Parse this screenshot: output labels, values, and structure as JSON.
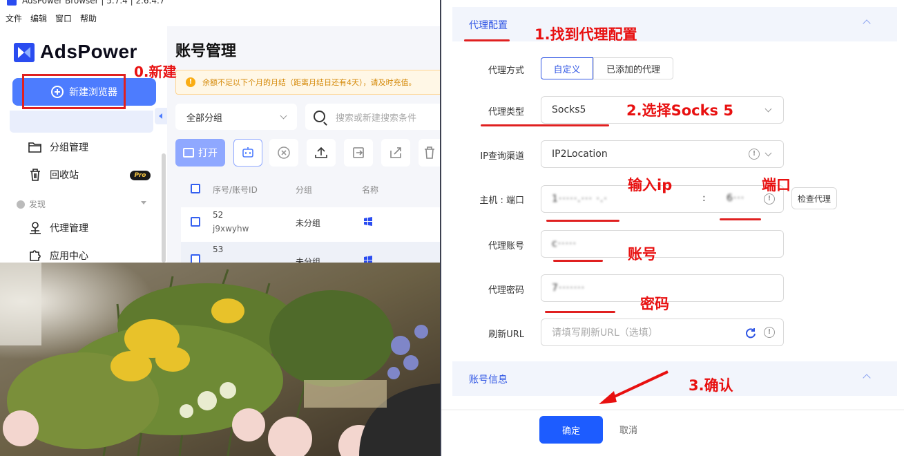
{
  "window": {
    "title": "AdsPower Browser | 5.7.4 | 2.6.4.7",
    "menu": [
      "文件",
      "编辑",
      "窗口",
      "帮助"
    ]
  },
  "sidebar": {
    "brand": "AdsPower",
    "new_browser_label": "新建浏览器",
    "active_item_label": "账号管理",
    "items": [
      {
        "label": "分组管理",
        "icon": "folder-icon"
      },
      {
        "label": "回收站",
        "icon": "trash-icon",
        "badge": "Pro"
      }
    ],
    "discover_label": "发现",
    "discover_items": [
      {
        "label": "代理管理",
        "icon": "proxy-icon"
      },
      {
        "label": "应用中心",
        "icon": "puzzle-icon"
      }
    ]
  },
  "main": {
    "page_title": "账号管理",
    "notice": "余额不足以下个月的月结（距离月结日还有4天），请及时充值。",
    "group_select": "全部分组",
    "search_placeholder": "搜索或新建搜索条件",
    "open_label": "打开",
    "table": {
      "headers": [
        "序号/账号ID",
        "分组",
        "名称"
      ],
      "rows": [
        {
          "idx": "52",
          "id": "j9xwyhw",
          "group": "未分组"
        },
        {
          "idx": "53",
          "id": "",
          "group": "未分组"
        }
      ]
    }
  },
  "dialog": {
    "section_proxy": "代理配置",
    "section_account": "账号信息",
    "fields": {
      "proxy_method_label": "代理方式",
      "proxy_method_options": [
        "自定义",
        "已添加的代理"
      ],
      "proxy_type_label": "代理类型",
      "proxy_type_value": "Socks5",
      "ip_channel_label": "IP查询渠道",
      "ip_channel_value": "IP2Location",
      "host_port_label": "主机 : 端口",
      "host_value": "1·····.··· ·.·",
      "port_separator": ":",
      "port_value": "6···",
      "check_proxy_label": "检查代理",
      "account_label": "代理账号",
      "account_value": "c·····",
      "password_label": "代理密码",
      "password_value": "7·······",
      "refresh_url_label": "刷新URL",
      "refresh_url_placeholder": "请填写刷新URL（选填）"
    },
    "confirm_label": "确定",
    "cancel_label": "取消"
  },
  "annotations": {
    "step0": "0.新建",
    "step1": "1.找到代理配置",
    "step2": "2.选择Socks 5",
    "input_ip": "输入ip",
    "port": "端口",
    "account": "账号",
    "password": "密码",
    "step3": "3.确认",
    "color": "#e81010"
  }
}
